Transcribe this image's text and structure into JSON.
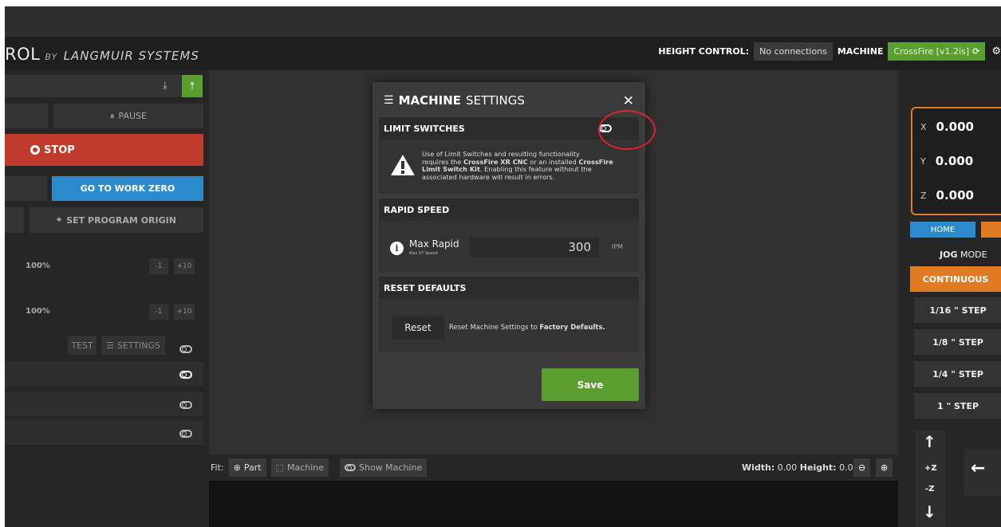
{
  "header": {
    "brand_main": "ROL",
    "brand_by": "BY",
    "brand_sub": "LANGMUIR SYSTEMS",
    "height_control_label": "HEIGHT CONTROL:",
    "height_control_value": "No connections",
    "machine_label": "MACHINE",
    "machine_value": "CrossFire [v1.2is]"
  },
  "left": {
    "pause_label": "PAUSE",
    "stop_label": "STOP",
    "go_to_work_zero_label": "GO TO WORK ZERO",
    "set_program_origin_label": "SET PROGRAM ORIGIN",
    "feed_override_1": "100%",
    "feed_override_2": "100%",
    "minus1": "-1",
    "plus10": "+10",
    "test_label": "TEST",
    "settings_label": "SETTINGS"
  },
  "modal": {
    "title_bold": "MACHINE",
    "title_rest": "SETTINGS",
    "limit_switches": {
      "header": "LIMIT SWITCHES",
      "warning_1": "Use of Limit Switches and resulting functionality",
      "warning_2a": "requires the ",
      "warning_2b": "CrossFire XR CNC",
      "warning_2c": " or an installed ",
      "warning_2d": "CrossFire",
      "warning_3a": "Limit Switch Kit",
      "warning_3b": ". Enabling this feature without the",
      "warning_4": "associated hardware will result in errors."
    },
    "rapid_speed": {
      "header": "RAPID SPEED",
      "label": "Max Rapid",
      "sublabel": "Max XY Speed",
      "value": "300",
      "unit": "IPM"
    },
    "reset_defaults": {
      "header": "RESET DEFAULTS",
      "button": "Reset",
      "text": "Reset Machine Settings to ",
      "text_bold": "Factory Defaults."
    },
    "save_label": "Save"
  },
  "fitbar": {
    "fit_label": "Fit:",
    "part_label": "Part",
    "machine_label": "Machine",
    "show_machine_label": "Show Machine",
    "width_label": "Width:",
    "width_value": "0.00",
    "height_label": "Height:",
    "height_value": "0.00"
  },
  "right": {
    "x_axis": "X",
    "x_value": "0.000",
    "y_axis": "Y",
    "y_value": "0.000",
    "z_axis": "Z",
    "z_value": "0.000",
    "home_label": "HOME",
    "jog_mode_bold": "JOG",
    "jog_mode_rest": "MODE",
    "continuous_label": "CONTINUOUS",
    "step_1_16": "1/16 \" STEP",
    "step_1_8": "1/8 \" STEP",
    "step_1_4": "1/4 \" STEP",
    "step_1": "1 \" STEP",
    "plus_z": "+Z",
    "minus_z": "-Z"
  },
  "colors": {
    "accent_orange": "#e07b24",
    "stop_red": "#c0392b",
    "blue": "#2b8acb",
    "green": "#5a9e2f",
    "annotation_red": "#e0202a"
  }
}
